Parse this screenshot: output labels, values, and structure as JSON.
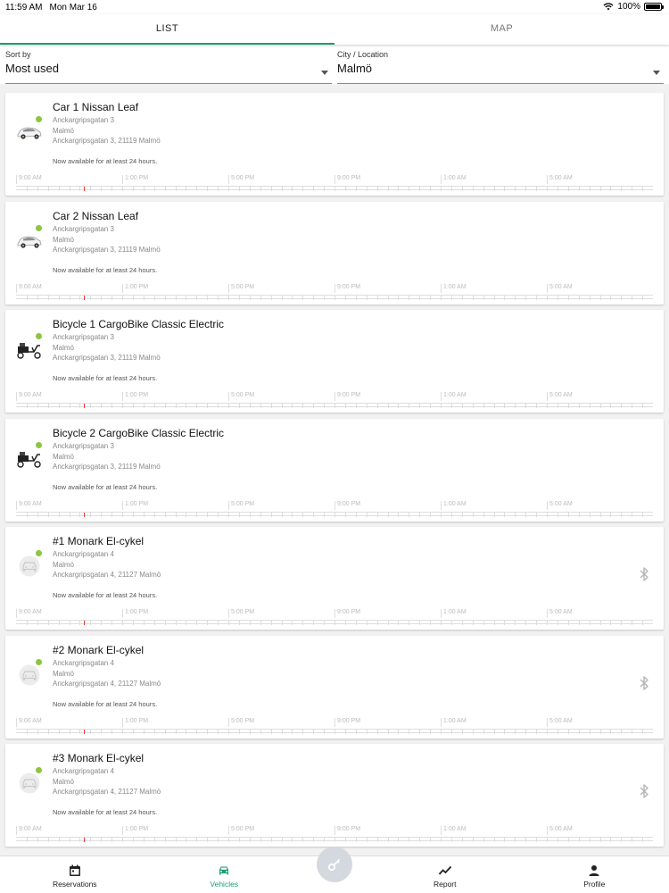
{
  "status_bar": {
    "time": "11:59 AM",
    "date": "Mon Mar 16",
    "battery": "100%",
    "battery_level": 1.0
  },
  "tabs": [
    {
      "label": "LIST",
      "active": true
    },
    {
      "label": "MAP",
      "active": false
    }
  ],
  "filters": {
    "sort": {
      "label": "Sort by",
      "value": "Most used"
    },
    "city": {
      "label": "City / Location",
      "value": "Malmö"
    }
  },
  "timeline_labels": [
    "9:00 AM",
    "1:00 PM",
    "5:00 PM",
    "9:00 PM",
    "1:00 AM",
    "5:00 AM"
  ],
  "vehicles": [
    {
      "name": "Car 1 Nissan Leaf",
      "address_line1": "Anckargripsgatan 3",
      "address_line2": "Malmö",
      "address_line3": "Anckargripsgatan 3, 21119 Malmö",
      "availability": "Now available for at least 24 hours.",
      "icon": "car-photo",
      "available": true,
      "bluetooth": false
    },
    {
      "name": "Car 2 Nissan Leaf",
      "address_line1": "Anckargripsgatan 3",
      "address_line2": "Malmö",
      "address_line3": "Anckargripsgatan 3, 21119 Malmö",
      "availability": "Now available for at least 24 hours.",
      "icon": "car-photo",
      "available": true,
      "bluetooth": false
    },
    {
      "name": "Bicycle 1 CargoBike Classic Electric",
      "address_line1": "Anckargripsgatan 3",
      "address_line2": "Malmö",
      "address_line3": "Anckargripsgatan 3, 21119 Malmö",
      "availability": "Now available for at least 24 hours.",
      "icon": "cargo-bike-photo",
      "available": true,
      "bluetooth": false
    },
    {
      "name": "Bicycle 2 CargoBike Classic Electric",
      "address_line1": "Anckargripsgatan 3",
      "address_line2": "Malmö",
      "address_line3": "Anckargripsgatan 3, 21119 Malmö",
      "availability": "Now available for at least 24 hours.",
      "icon": "cargo-bike-photo",
      "available": true,
      "bluetooth": false
    },
    {
      "name": "#1 Monark El-cykel",
      "address_line1": "Anckargripsgatan 4",
      "address_line2": "Malmö",
      "address_line3": "Anckargripsgatan 4, 21127 Malmö",
      "availability": "Now available for at least 24 hours.",
      "icon": "car-placeholder",
      "available": true,
      "bluetooth": true
    },
    {
      "name": "#2 Monark El-cykel",
      "address_line1": "Anckargripsgatan 4",
      "address_line2": "Malmö",
      "address_line3": "Anckargripsgatan 4, 21127 Malmö",
      "availability": "Now available for at least 24 hours.",
      "icon": "car-placeholder",
      "available": true,
      "bluetooth": true
    },
    {
      "name": "#3 Monark El-cykel",
      "address_line1": "Anckargripsgatan 4",
      "address_line2": "Malmö",
      "address_line3": "Anckargripsgatan 4, 21127 Malmö",
      "availability": "Now available for at least 24 hours.",
      "icon": "car-placeholder",
      "available": true,
      "bluetooth": true
    }
  ],
  "bottom_nav": [
    {
      "label": "Reservations",
      "icon": "calendar-icon",
      "active": false
    },
    {
      "label": "Vehicles",
      "icon": "car-icon",
      "active": true
    },
    {
      "label": "Report",
      "icon": "trend-icon",
      "active": false
    },
    {
      "label": "Profile",
      "icon": "person-icon",
      "active": false
    }
  ],
  "fab": {
    "icon": "key-icon"
  },
  "colors": {
    "accent": "#1b9e6e",
    "available_dot": "#8cc63f",
    "now_marker": "#e53935"
  }
}
